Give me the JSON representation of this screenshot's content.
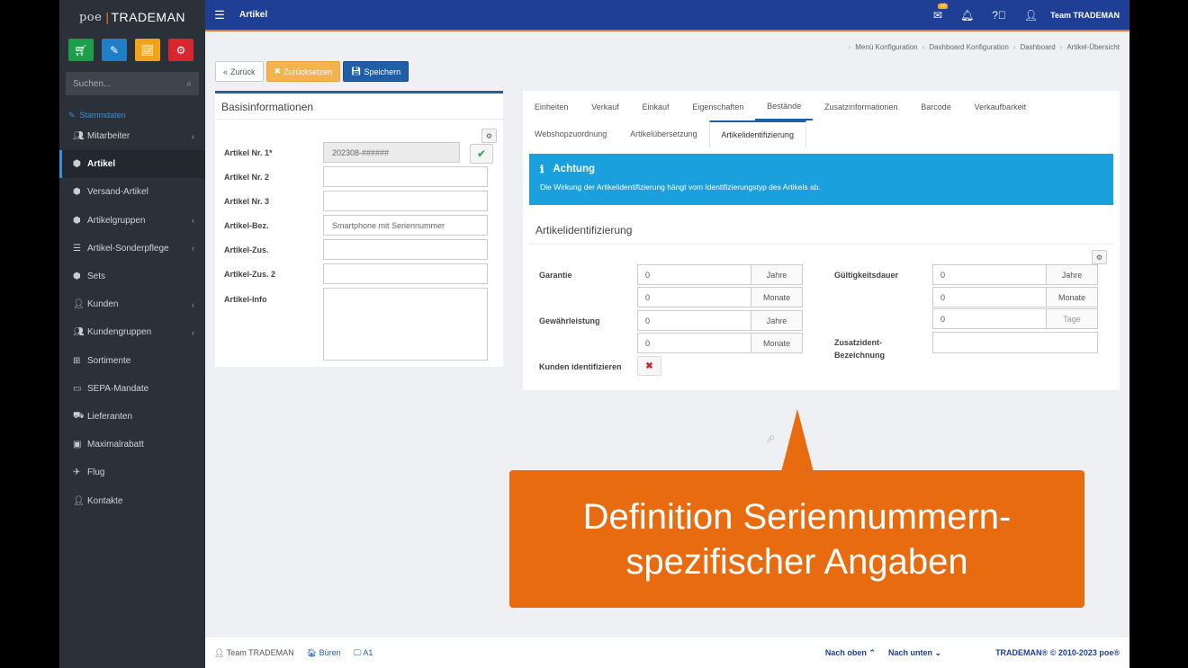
{
  "app": {
    "logo_prefix": "poe",
    "logo_name": "TRADEMAN"
  },
  "sidebar": {
    "search_placeholder": "Suchen...",
    "section_label": "Stammdaten",
    "items": [
      {
        "label": "Mitarbeiter",
        "icon": "users-icon",
        "chevron": true
      },
      {
        "label": "Artikel",
        "icon": "box-icon",
        "chevron": false,
        "active": true
      },
      {
        "label": "Versand-Artikel",
        "icon": "box-icon",
        "chevron": false
      },
      {
        "label": "Artikelgruppen",
        "icon": "cubes-icon",
        "chevron": true
      },
      {
        "label": "Artikel-Sonderpflege",
        "icon": "list-icon",
        "chevron": true
      },
      {
        "label": "Sets",
        "icon": "cubes-icon",
        "chevron": false
      },
      {
        "label": "Kunden",
        "icon": "user-icon",
        "chevron": true
      },
      {
        "label": "Kundengruppen",
        "icon": "users-icon",
        "chevron": true
      },
      {
        "label": "Sortimente",
        "icon": "sitemap-icon",
        "chevron": false
      },
      {
        "label": "SEPA-Mandate",
        "icon": "card-icon",
        "chevron": false
      },
      {
        "label": "Lieferanten",
        "icon": "truck-icon",
        "chevron": false
      },
      {
        "label": "Maximalrabatt",
        "icon": "money-icon",
        "chevron": false
      },
      {
        "label": "Flug",
        "icon": "plane-icon",
        "chevron": false
      },
      {
        "label": "Kontakte",
        "icon": "contact-icon",
        "chevron": false
      }
    ]
  },
  "topbar": {
    "title": "Artikel",
    "badge": "19",
    "user": "Team TRADEMAN"
  },
  "breadcrumb": [
    "Menü Konfiguration",
    "Dashboard Konfiguration",
    "Dashboard",
    "Artikel-Übersicht"
  ],
  "actions": {
    "back": "Zurück",
    "reset": "Zurücksetzen",
    "save": "Speichern"
  },
  "basis": {
    "title": "Basisinformationen",
    "fields": [
      {
        "label": "Artikel Nr. 1*",
        "value": "202308-######"
      },
      {
        "label": "Artikel Nr. 2",
        "value": ""
      },
      {
        "label": "Artikel Nr. 3",
        "value": ""
      },
      {
        "label": "Artikel-Bez.",
        "value": "Smartphone mit Seriennummer"
      },
      {
        "label": "Artikel-Zus.",
        "value": ""
      },
      {
        "label": "Artikel-Zus. 2",
        "value": ""
      },
      {
        "label": "Artikel-Info",
        "value": ""
      }
    ]
  },
  "tabs": {
    "row1": [
      "Einheiten",
      "Verkauf",
      "Einkauf",
      "Eigenschaften",
      "Bestände",
      "Zusatzinformationen",
      "Barcode",
      "Verkaufbarkeit"
    ],
    "row2": [
      "Webshopzuordnung",
      "Artikelübersetzung",
      "Artikelidentifizierung"
    ],
    "active": "Artikelidentifizierung"
  },
  "alert": {
    "title": "Achtung",
    "body": "Die Wirkung der Artikelidentifizierung hängt vom Identifizierungstyp des Artikels ab."
  },
  "ident": {
    "title": "Artikelidentifizierung",
    "garantie_label": "Garantie",
    "gewaehr_label": "Gewährleistung",
    "kunden_label": "Kunden identifizieren",
    "gueltig_label": "Gültigkeitsdauer",
    "zusatz_label_1": "Zusatzident-",
    "zusatz_label_2": "Bezeichnung",
    "garantie_years": "0",
    "garantie_months": "0",
    "gewaehr_years": "0",
    "gewaehr_months": "0",
    "gueltig_years": "0",
    "gueltig_months": "0",
    "gueltig_days": "0",
    "unit_years": "Jahre",
    "unit_months": "Monate",
    "unit_days": "Tage"
  },
  "callout": {
    "line1": "Definition Seriennummern-",
    "line2": "spezifischer Angaben"
  },
  "footer": {
    "user": "Team TRADEMAN",
    "location": "Büren",
    "terminal": "A1",
    "up": "Nach oben",
    "down": "Nach unten",
    "copyright": "TRADEMAN® © 2010-2023 poe®"
  }
}
